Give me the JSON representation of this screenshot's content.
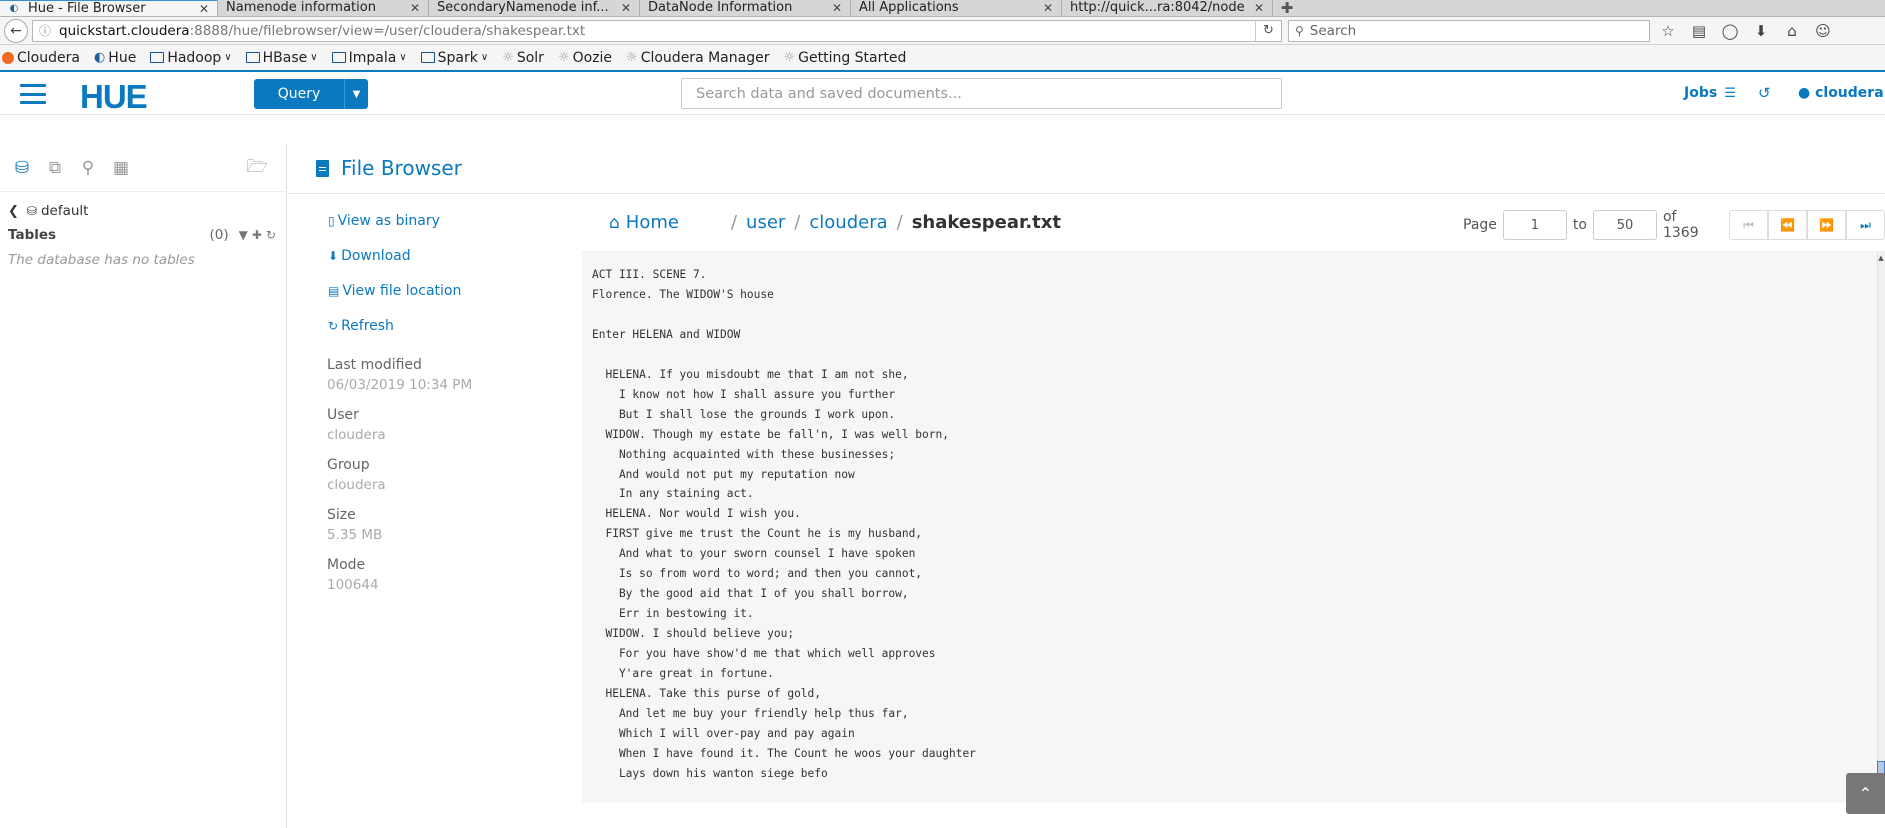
{
  "browser": {
    "tabs": [
      {
        "label": "Hue - File Browser",
        "active": true,
        "icon": "hue-favicon"
      },
      {
        "label": "Namenode information",
        "active": false
      },
      {
        "label": "SecondaryNamenode inf...",
        "active": false
      },
      {
        "label": "DataNode Information",
        "active": false
      },
      {
        "label": "All Applications",
        "active": false
      },
      {
        "label": "http://quick...ra:8042/node",
        "active": false
      }
    ],
    "url_host": "quickstart.cloudera",
    "url_path": ":8888/hue/filebrowser/view=/user/cloudera/shakespear.txt",
    "search_placeholder": "Search",
    "bookmarks": [
      {
        "label": "Cloudera",
        "icon": "cloudera-icon"
      },
      {
        "label": "Hue",
        "icon": "hue-icon"
      },
      {
        "label": "Hadoop",
        "icon": "folder-icon",
        "dropdown": true
      },
      {
        "label": "HBase",
        "icon": "folder-icon",
        "dropdown": true
      },
      {
        "label": "Impala",
        "icon": "folder-icon",
        "dropdown": true
      },
      {
        "label": "Spark",
        "icon": "folder-icon",
        "dropdown": true
      },
      {
        "label": "Solr",
        "icon": "globe-icon"
      },
      {
        "label": "Oozie",
        "icon": "globe-icon"
      },
      {
        "label": "Cloudera Manager",
        "icon": "globe-icon"
      },
      {
        "label": "Getting Started",
        "icon": "globe-icon"
      }
    ]
  },
  "hue": {
    "logo": "HUE",
    "query_label": "Query",
    "search_placeholder": "Search data and saved documents...",
    "jobs_label": "Jobs",
    "user_label": "cloudera"
  },
  "assist": {
    "database": "default",
    "tables_label": "Tables",
    "tables_count": "(0)",
    "empty_message": "The database has no tables"
  },
  "filebrowser": {
    "title": "File Browser",
    "actions": {
      "view_binary": "View as binary",
      "download": "Download",
      "view_location": "View file location",
      "refresh": "Refresh"
    },
    "meta": {
      "last_modified_label": "Last modified",
      "last_modified": "06/03/2019 10:34 PM",
      "user_label": "User",
      "user": "cloudera",
      "group_label": "Group",
      "group": "cloudera",
      "size_label": "Size",
      "size": "5.35 MB",
      "mode_label": "Mode",
      "mode": "100644"
    },
    "breadcrumbs": {
      "home": "Home",
      "parts": [
        "user",
        "cloudera"
      ],
      "file": "shakespear.txt"
    },
    "pager": {
      "page_label": "Page",
      "from": "1",
      "to_label": "to",
      "to": "50",
      "of_label": "of 1369"
    },
    "file_content": "ACT III. SCENE 7.\nFlorence. The WIDOW'S house\n\nEnter HELENA and WIDOW\n\n  HELENA. If you misdoubt me that I am not she,\n    I know not how I shall assure you further\n    But I shall lose the grounds I work upon.\n  WIDOW. Though my estate be fall'n, I was well born,\n    Nothing acquainted with these businesses;\n    And would not put my reputation now\n    In any staining act.\n  HELENA. Nor would I wish you.\n  FIRST give me trust the Count he is my husband,\n    And what to your sworn counsel I have spoken\n    Is so from word to word; and then you cannot,\n    By the good aid that I of you shall borrow,\n    Err in bestowing it.\n  WIDOW. I should believe you;\n    For you have show'd me that which well approves\n    Y'are great in fortune.\n  HELENA. Take this purse of gold,\n    And let me buy your friendly help thus far,\n    Which I will over-pay and pay again\n    When I have found it. The Count he woos your daughter\n    Lays down his wanton siege befo"
  }
}
